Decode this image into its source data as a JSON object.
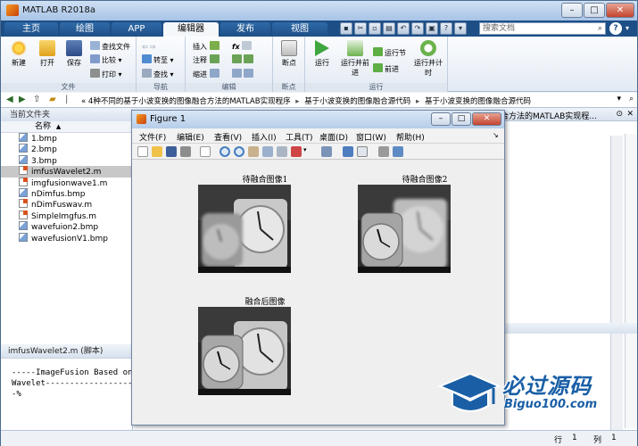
{
  "app": {
    "title": "MATLAB R2018a"
  },
  "tabs": [
    {
      "label": "主页"
    },
    {
      "label": "绘图"
    },
    {
      "label": "APP"
    },
    {
      "label": "编辑器"
    },
    {
      "label": "发布"
    },
    {
      "label": "视图"
    }
  ],
  "search": {
    "placeholder": "搜索文档"
  },
  "ribbon": {
    "file": {
      "title": "文件",
      "new_label": "新建",
      "open_label": "打开",
      "save_label": "保存",
      "find_files_label": "查找文件",
      "compare_label": "比较",
      "print_label": "打印"
    },
    "navigate": {
      "title": "导航",
      "goto_label": "转至",
      "find_label": "查找"
    },
    "edit": {
      "title": "编辑",
      "insert_label": "插入",
      "comment_label": "注释",
      "indent_label": "缩进",
      "fx_label": "fx"
    },
    "breakpoints": {
      "title": "断点",
      "bp_label": "断点"
    },
    "run": {
      "title": "运行",
      "run_label": "运行",
      "run_advance_label": "运行并前进",
      "run_section_label": "运行节",
      "advance_label": "前进",
      "run_time_label": "运行并计时"
    }
  },
  "path": {
    "crumbs": [
      "4种不同的基于小波变换的图像融合方法的MATLAB实现程序",
      "基于小波变换的图像融合源代码",
      "基于小波变换的图像融合源代码"
    ],
    "prefix": "«"
  },
  "current_folder": {
    "title": "当前文件夹",
    "column": "名称",
    "sort_indicator": "▲",
    "files": [
      {
        "name": "1.bmp",
        "type": "bmp"
      },
      {
        "name": "2.bmp",
        "type": "bmp"
      },
      {
        "name": "3.bmp",
        "type": "bmp"
      },
      {
        "name": "imfusWavelet2.m",
        "type": "m",
        "selected": true
      },
      {
        "name": "imgfusionwave1.m",
        "type": "m"
      },
      {
        "name": "nDimfus.bmp",
        "type": "bmp"
      },
      {
        "name": "nDimFuswav.m",
        "type": "m"
      },
      {
        "name": "SimpleImgfus.m",
        "type": "m"
      },
      {
        "name": "wavefuion2.bmp",
        "type": "bmp"
      },
      {
        "name": "wavefusionV1.bmp",
        "type": "bmp"
      }
    ]
  },
  "details": {
    "title": "imfusWavelet2.m  (脚本)",
    "body": "-----ImageFusion Based on\nWavelet----------------------\n-%"
  },
  "editor": {
    "header_text": "合方法的MATLAB实现程..."
  },
  "figure": {
    "title": "Figure 1",
    "menu": [
      "文件(F)",
      "编辑(E)",
      "查看(V)",
      "插入(I)",
      "工具(T)",
      "桌面(D)",
      "窗口(W)",
      "帮助(H)"
    ],
    "images": [
      {
        "title": "待融合图像1"
      },
      {
        "title": "待融合图像2"
      },
      {
        "title": "融合后图像"
      }
    ]
  },
  "status": {
    "row_label": "行",
    "row_value": "1",
    "col_label": "列",
    "col_value": "1"
  },
  "watermark": {
    "cn": "必过源码",
    "en": "Biguo100.com"
  }
}
